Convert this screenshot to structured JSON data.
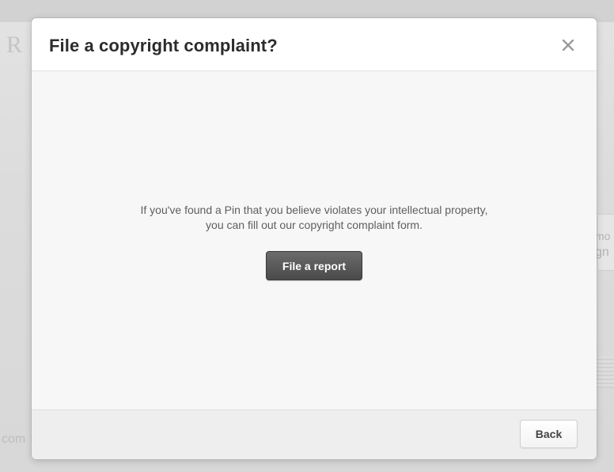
{
  "background": {
    "left_letter": "R",
    "right_text_1": "mo",
    "right_text_2": "gn",
    "left_text": "com"
  },
  "modal": {
    "title": "File a copyright complaint?",
    "close_icon": "close-icon",
    "body": {
      "line_1": "If you've found a Pin that you believe violates your intellectual property,",
      "line_2": "you can fill out our copyright complaint form."
    },
    "file_report_label": "File a report",
    "back_label": "Back"
  },
  "colors": {
    "primary_button": "#4f4f4f",
    "modal_background": "#f5f5f5",
    "overlay": "#dcdcdc"
  }
}
